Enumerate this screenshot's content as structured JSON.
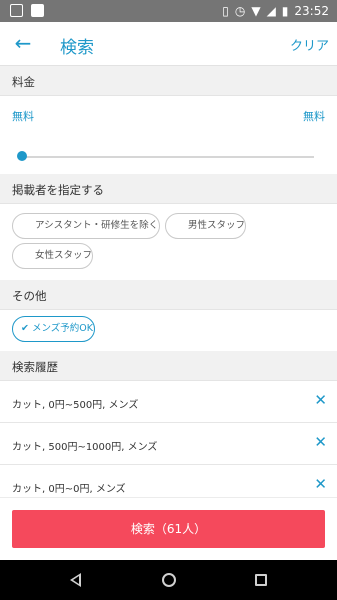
{
  "status_bar": {
    "time": "23:52",
    "icons": [
      "gallery-icon",
      "mail-icon",
      "vibrate-icon",
      "alarm-icon",
      "wifi-icon",
      "signal-icon",
      "battery-icon"
    ]
  },
  "app_bar": {
    "title": "検索",
    "clear_label": "クリア"
  },
  "sections": {
    "price": "料金",
    "advertiser": "掲載者を指定する",
    "other": "その他",
    "history": "検索履歴"
  },
  "price": {
    "min": "無料",
    "max": "無料",
    "slider_position": 0
  },
  "advertiser_chips": [
    {
      "label": "アシスタント・研修生を除く",
      "selected": false
    },
    {
      "label": "男性スタッフ",
      "selected": false
    },
    {
      "label": "女性スタッフ",
      "selected": false
    }
  ],
  "other_chips": [
    {
      "label": "✔ メンズ予約OK",
      "selected": true
    }
  ],
  "history": [
    {
      "text": "カット, 0円~500円, メンズ"
    },
    {
      "text": "カット, 500円~1000円, メンズ"
    },
    {
      "text": "カット, 0円~0円, メンズ"
    }
  ],
  "search_button": {
    "label": "検索（61人）",
    "color": "#f5495c"
  },
  "colors": {
    "accent": "#1e98c9",
    "status_bar": "#757575"
  }
}
